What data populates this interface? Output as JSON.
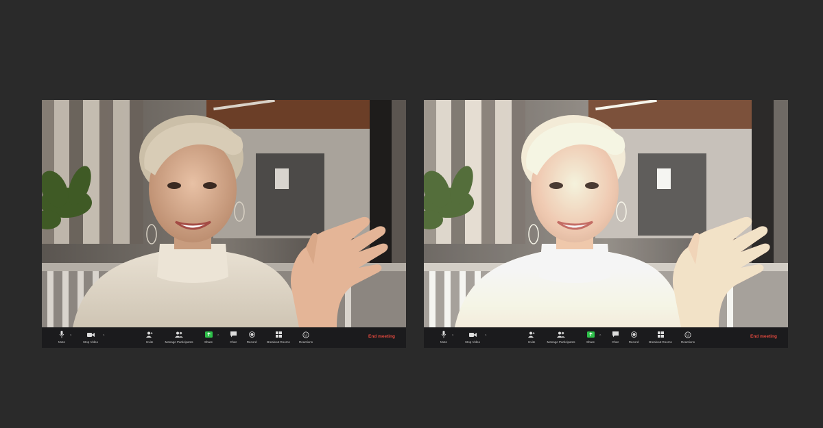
{
  "panels": [
    {
      "toolbar": {
        "mute_label": "Mute",
        "stop_video_label": "Stop Video",
        "invite_label": "Invite",
        "manage_participants_label": "Manage Participants",
        "share_label": "Share",
        "chat_label": "Chat",
        "record_label": "Record",
        "breakout_rooms_label": "Breakout Rooms",
        "reactions_label": "Reactions",
        "end_meeting_label": "End meeting",
        "caret": "^"
      }
    },
    {
      "toolbar": {
        "mute_label": "Mute",
        "stop_video_label": "Stop Video",
        "invite_label": "Invite",
        "manage_participants_label": "Manage Participants",
        "share_label": "Share",
        "chat_label": "Chat",
        "record_label": "Record",
        "breakout_rooms_label": "Breakout Rooms",
        "reactions_label": "Reactions",
        "end_meeting_label": "End meeting",
        "caret": "^"
      }
    }
  ],
  "colors": {
    "background": "#2a2a2a",
    "toolbar": "#1b1b1d",
    "share_green": "#2ec04a",
    "end_meeting_red": "#e0483e"
  }
}
